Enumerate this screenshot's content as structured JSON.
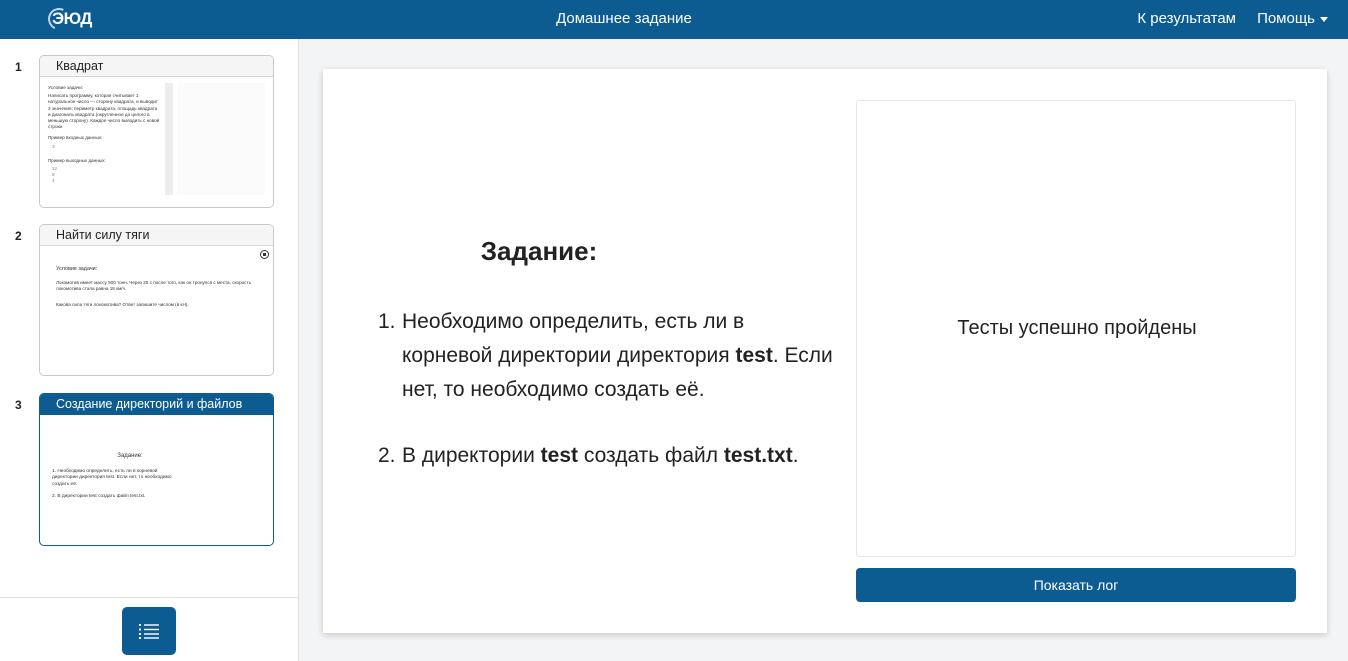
{
  "header": {
    "logo": "ЭЮД",
    "title": "Домашнее задание",
    "results_link": "К результатам",
    "help_menu": "Помощь"
  },
  "sidebar": {
    "tasks": [
      {
        "number": "1",
        "title": "Квадрат",
        "preview": {
          "heading": "Условие задачи:",
          "text": "Написать программу, которая считывает 1 натуральное число — сторону квадрата, и выводит 3 значения: периметр квадрата, площадь квадрата и диагональ квадрата (округленное до целого в меньшую сторону). Каждое число выводить с новой строки",
          "input_label": "Пример входных данных:",
          "input_value": "3",
          "output_label": "Пример выходных данных:",
          "output_values": [
            "12",
            "9",
            "4"
          ]
        }
      },
      {
        "number": "2",
        "title": "Найти силу тяги",
        "preview": {
          "heading": "Условие задачи:",
          "text": "Локомотив имеет массу 500 тонн. Через 25 с после того, как он тронулся с места, скорость локомотива стала равна 18 км/ч.",
          "question": "Какова сила тяги локомотива? Ответ запишите числом (в кН)."
        }
      },
      {
        "number": "3",
        "title": "Создание директорий и файлов",
        "preview": {
          "heading": "Задание:",
          "item1": "1. Необходимо определить, есть ли в корневой директории директория test. Если нет, то необходимо создать её.",
          "item2": "2. В директории test создать файл test.txt."
        }
      }
    ]
  },
  "main": {
    "heading": "Задание:",
    "items": [
      {
        "number": "1.",
        "part1": "Необходимо определить, есть ли в корневой директории директория ",
        "bold1": "test",
        "part2": ". Если нет, то необходимо создать её."
      },
      {
        "number": "2.",
        "part1": "В директории ",
        "bold1": "test",
        "part2": " создать файл ",
        "bold2": "test.txt",
        "part3": "."
      }
    ],
    "result_text": "Тесты успешно пройдены",
    "show_log_label": "Показать лог"
  },
  "colors": {
    "primary": "#0d5c91",
    "background": "#f3f4f6"
  },
  "icons": {
    "list_button": "list-icon",
    "help_dropdown": "caret-down-icon",
    "task2_control": "stop-icon"
  }
}
